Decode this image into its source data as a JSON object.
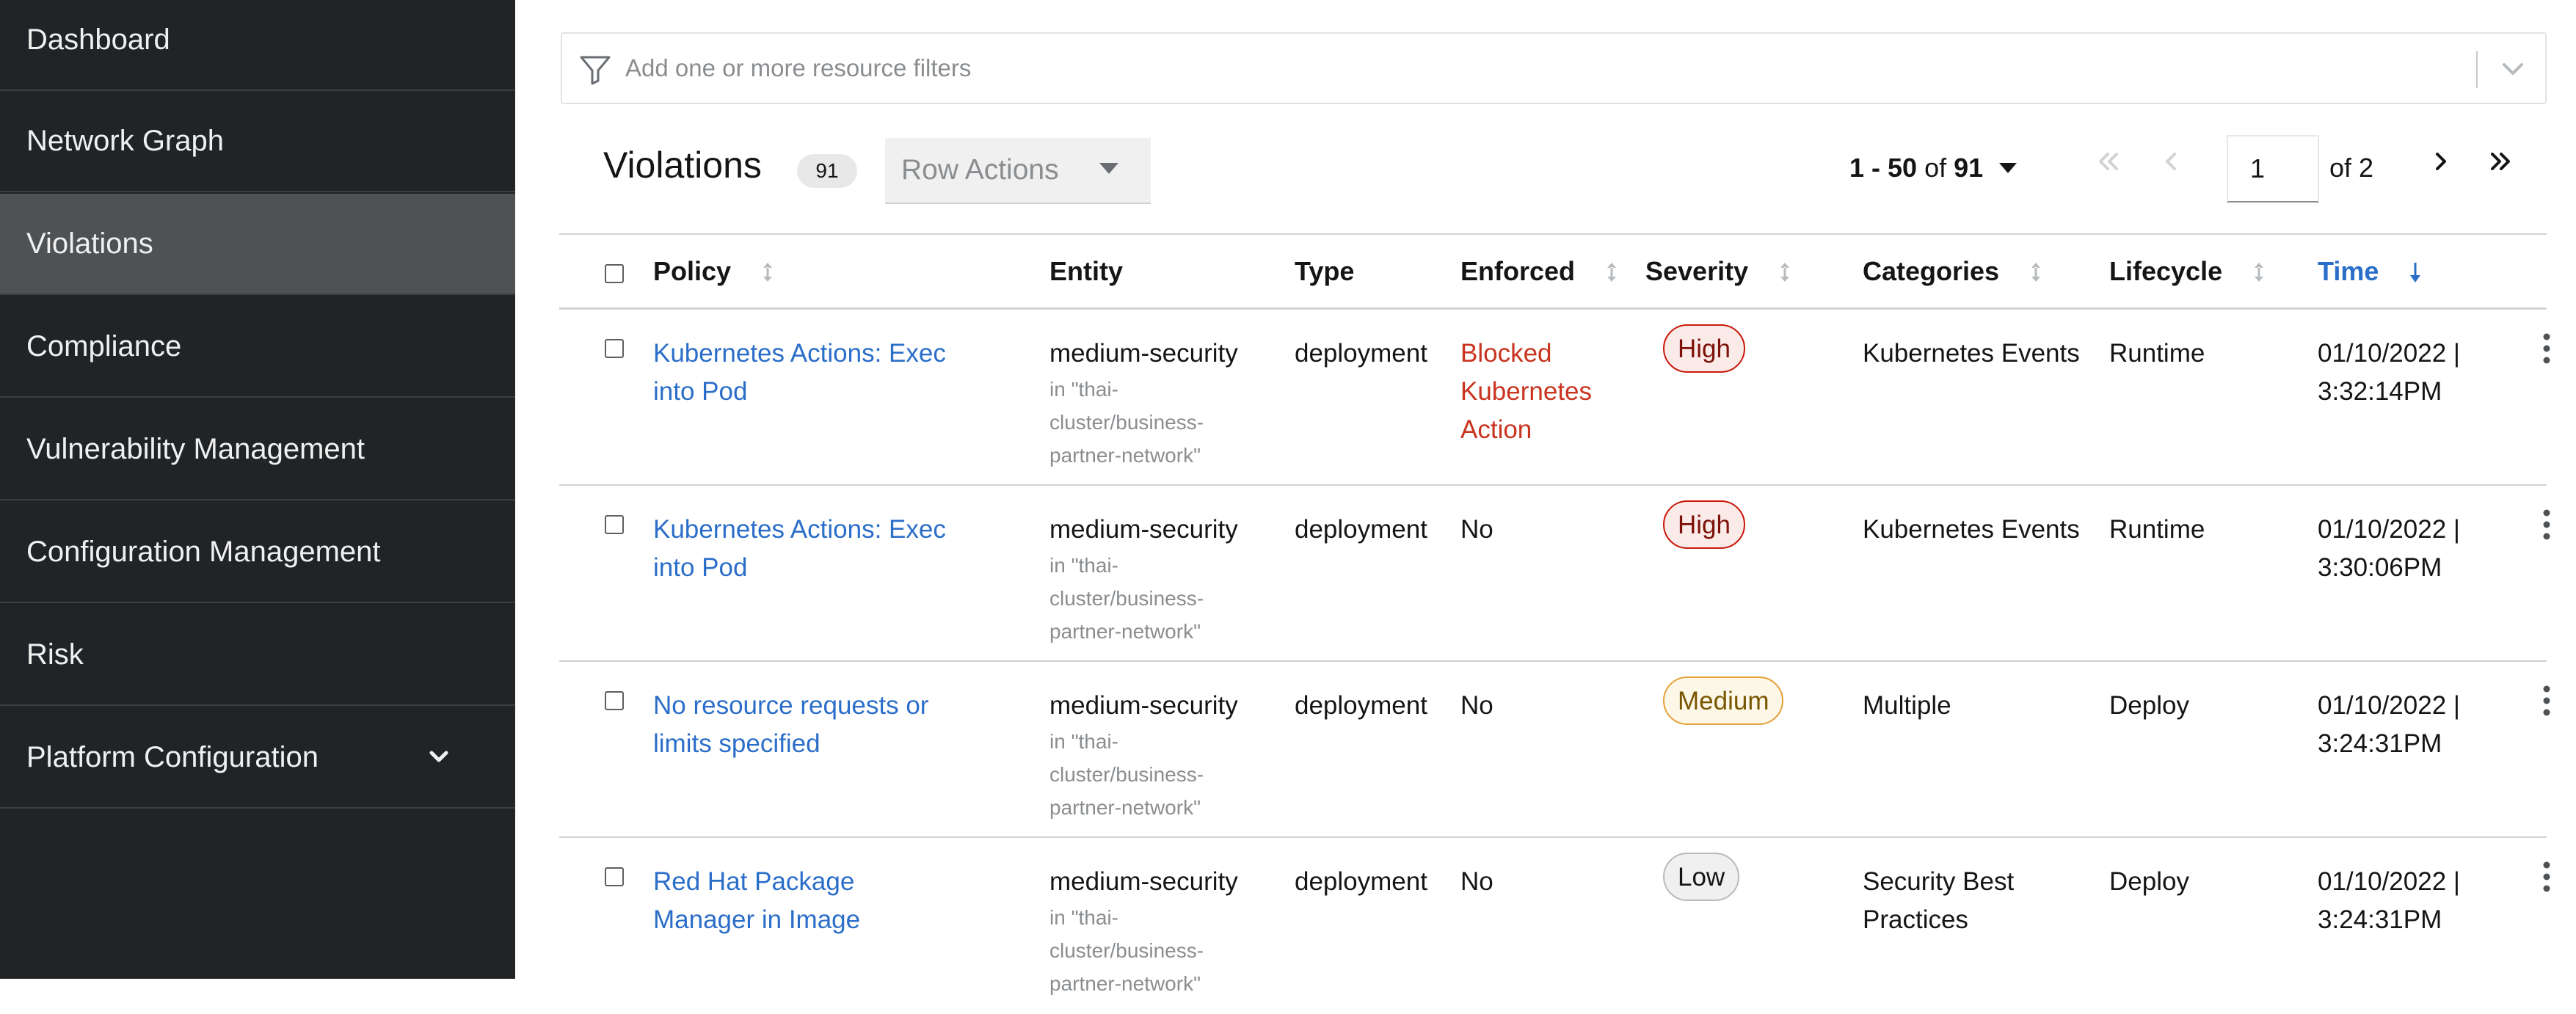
{
  "sidebar": {
    "items": [
      {
        "label": "Dashboard"
      },
      {
        "label": "Network Graph"
      },
      {
        "label": "Violations",
        "active": true
      },
      {
        "label": "Compliance"
      },
      {
        "label": "Vulnerability Management"
      },
      {
        "label": "Configuration Management"
      },
      {
        "label": "Risk"
      },
      {
        "label": "Platform Configuration",
        "expandable": true
      }
    ]
  },
  "filter": {
    "placeholder": "Add one or more resource filters",
    "icon": "filter-icon"
  },
  "header": {
    "title": "Violations",
    "count": "91",
    "row_actions_label": "Row Actions"
  },
  "pagination": {
    "range": "1 - 50",
    "of_label": "of",
    "total": "91",
    "page": "1",
    "of_pages": "of 2"
  },
  "table": {
    "columns": {
      "policy": "Policy",
      "entity": "Entity",
      "type": "Type",
      "enforced": "Enforced",
      "severity": "Severity",
      "categories": "Categories",
      "lifecycle": "Lifecycle",
      "time": "Time"
    },
    "rows": [
      {
        "policy": "Kubernetes Actions: Exec into Pod",
        "entity": "medium-security",
        "entity_sub": "in \"thai-cluster/business-partner-network\"",
        "type": "deployment",
        "enforced": "Blocked Kubernetes Action",
        "severity": "High",
        "categories": "Kubernetes Events",
        "lifecycle": "Runtime",
        "time": "01/10/2022 | 3:32:14PM"
      },
      {
        "policy": "Kubernetes Actions: Exec into Pod",
        "entity": "medium-security",
        "entity_sub": "in \"thai-cluster/business-partner-network\"",
        "type": "deployment",
        "enforced": "No",
        "severity": "High",
        "categories": "Kubernetes Events",
        "lifecycle": "Runtime",
        "time": "01/10/2022 | 3:30:06PM"
      },
      {
        "policy": "No resource requests or limits specified",
        "entity": "medium-security",
        "entity_sub": "in \"thai-cluster/business-partner-network\"",
        "type": "deployment",
        "enforced": "No",
        "severity": "Medium",
        "categories": "Multiple",
        "lifecycle": "Deploy",
        "time": "01/10/2022 | 3:24:31PM"
      },
      {
        "policy": "Red Hat Package Manager in Image",
        "entity": "medium-security",
        "entity_sub": "in \"thai-cluster/business-partner-network\"",
        "type": "deployment",
        "enforced": "No",
        "severity": "Low",
        "categories": "Security Best Practices",
        "lifecycle": "Deploy",
        "time": "01/10/2022 | 3:24:31PM"
      }
    ]
  },
  "colors": {
    "sidebar_bg": "#212427",
    "sidebar_active": "#4f5255",
    "link": "#2b6ec9",
    "blocked": "#c9341f"
  }
}
